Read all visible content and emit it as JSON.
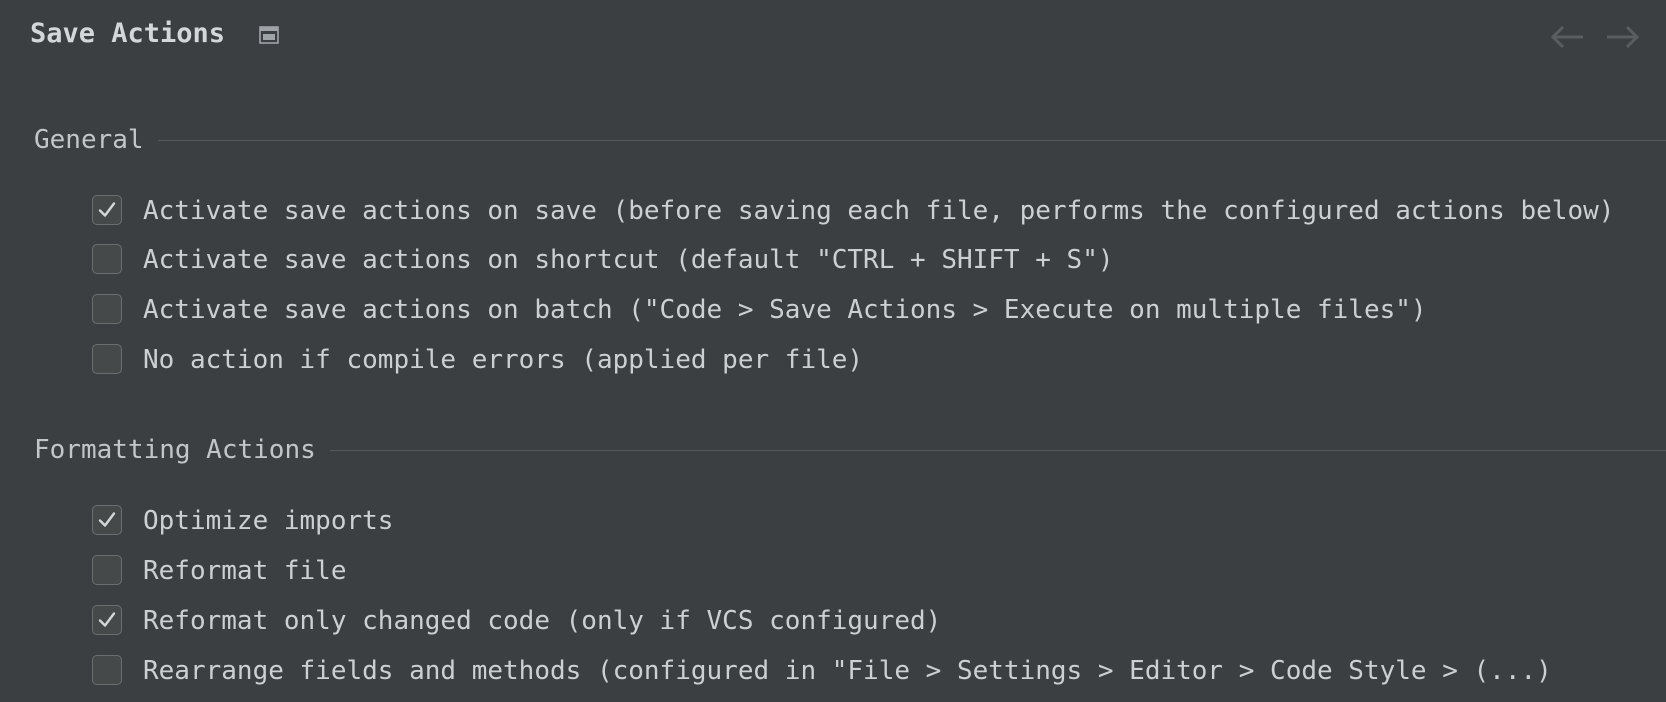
{
  "header": {
    "title": "Save Actions",
    "window_icon": "window-icon",
    "back_icon": "arrow-left-icon",
    "forward_icon": "arrow-right-icon"
  },
  "sections": [
    {
      "title": "General",
      "options": [
        {
          "label": "Activate save actions on save (before saving each file, performs the configured actions below)",
          "checked": true
        },
        {
          "label": "Activate save actions on shortcut (default \"CTRL + SHIFT + S\")",
          "checked": false
        },
        {
          "label": "Activate save actions on batch (\"Code > Save Actions > Execute on multiple files\")",
          "checked": false
        },
        {
          "label": "No action if compile errors (applied per file)",
          "checked": false
        }
      ]
    },
    {
      "title": "Formatting Actions",
      "options": [
        {
          "label": "Optimize imports",
          "checked": true
        },
        {
          "label": "Reformat file",
          "checked": false
        },
        {
          "label": "Reformat only changed code (only if VCS configured)",
          "checked": true
        },
        {
          "label": "Rearrange fields and methods (configured in \"File > Settings > Editor > Code Style > (...)",
          "checked": false
        }
      ]
    }
  ],
  "colors": {
    "background": "#3c3f41",
    "text": "#cdd0d3",
    "checkmark": "#d4d7da",
    "checkbox_border": "#6b6e71",
    "rule": "#55585b"
  }
}
